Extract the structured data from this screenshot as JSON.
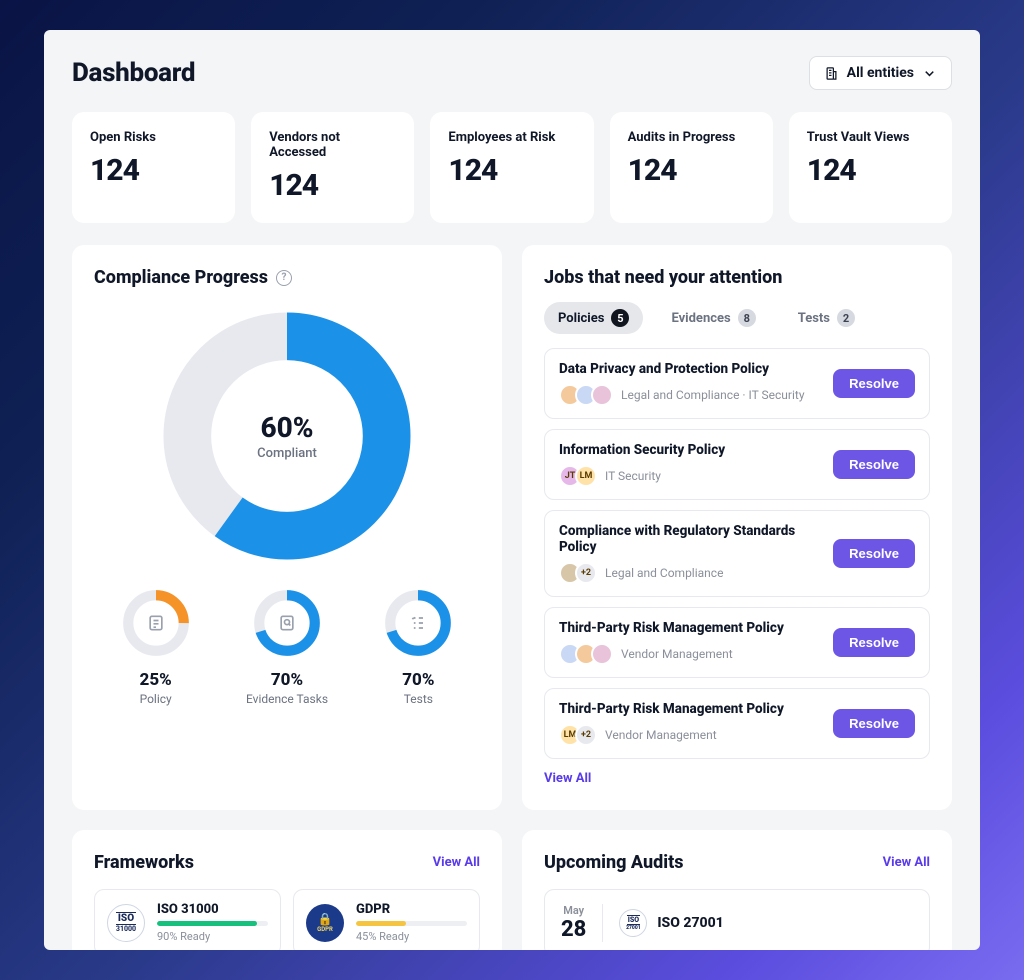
{
  "page_title": "Dashboard",
  "entity_selector": {
    "label": "All entities"
  },
  "stats": [
    {
      "label": "Open Risks",
      "value": "124"
    },
    {
      "label": "Vendors not Accessed",
      "value": "124"
    },
    {
      "label": "Employees at Risk",
      "value": "124"
    },
    {
      "label": "Audits in Progress",
      "value": "124"
    },
    {
      "label": "Trust Vault Views",
      "value": "124"
    }
  ],
  "compliance": {
    "title": "Compliance Progress",
    "main_pct": "60%",
    "main_sub": "Compliant",
    "mini": [
      {
        "pct": "25%",
        "label": "Policy",
        "color": "#f59328",
        "value": 25
      },
      {
        "pct": "70%",
        "label": "Evidence Tasks",
        "color": "#1c91e8",
        "value": 70
      },
      {
        "pct": "70%",
        "label": "Tests",
        "color": "#1c91e8",
        "value": 70
      }
    ]
  },
  "chart_data": {
    "type": "pie",
    "title": "Compliance Progress",
    "series": [
      {
        "name": "Compliant",
        "value": 60
      },
      {
        "name": "Remaining",
        "value": 40
      }
    ],
    "sub_charts": [
      {
        "name": "Policy",
        "value": 25,
        "type": "donut"
      },
      {
        "name": "Evidence Tasks",
        "value": 70,
        "type": "donut"
      },
      {
        "name": "Tests",
        "value": 70,
        "type": "donut"
      }
    ]
  },
  "jobs": {
    "title": "Jobs that need your attention",
    "tabs": [
      {
        "label": "Policies",
        "count": "5",
        "active": true
      },
      {
        "label": "Evidences",
        "count": "8",
        "active": false
      },
      {
        "label": "Tests",
        "count": "2",
        "active": false
      }
    ],
    "items": [
      {
        "title": "Data Privacy and Protection Policy",
        "dept": "Legal and Compliance · IT Security",
        "avatars": [
          {
            "bg": "#f4c99b"
          },
          {
            "bg": "#c9d8f4"
          },
          {
            "bg": "#e8c3d9"
          }
        ]
      },
      {
        "title": "Information Security Policy",
        "dept": "IT Security",
        "avatars": [
          {
            "bg": "#e6b8ea",
            "text": "JT"
          },
          {
            "bg": "#ffe2a8",
            "text": "LM"
          }
        ]
      },
      {
        "title": "Compliance with Regulatory Standards Policy",
        "dept": "Legal and Compliance",
        "avatars": [
          {
            "bg": "#d8c6a8"
          },
          {
            "bg": "#e7e9ee",
            "text": "+2"
          }
        ]
      },
      {
        "title": "Third-Party Risk Management Policy",
        "dept": "Vendor Management",
        "avatars": [
          {
            "bg": "#c9d8f4"
          },
          {
            "bg": "#f4c99b"
          },
          {
            "bg": "#e8c3d9"
          }
        ]
      },
      {
        "title": "Third-Party Risk Management Policy",
        "dept": "Vendor Management",
        "avatars": [
          {
            "bg": "#ffe2a8",
            "text": "LM"
          },
          {
            "bg": "#e7e9ee",
            "text": "+2"
          }
        ]
      }
    ],
    "resolve_label": "Resolve",
    "view_all": "View All"
  },
  "frameworks": {
    "title": "Frameworks",
    "view_all": "View All",
    "items": [
      {
        "name": "ISO 31000",
        "ready": "90% Ready",
        "pct": 90,
        "color": "#17c07d",
        "icon": "ISO",
        "icon_sub": "31000",
        "icon_bg": "#fff",
        "icon_border": "#1a2a5a"
      },
      {
        "name": "GDPR",
        "ready": "45% Ready",
        "pct": 45,
        "color": "#f5c542",
        "icon": "GDPR",
        "icon_bg": "#1b3a8a",
        "icon_color": "#f5d862"
      }
    ]
  },
  "audits": {
    "title": "Upcoming Audits",
    "view_all": "View All",
    "items": [
      {
        "month": "May",
        "day": "28",
        "name": "ISO 27001"
      }
    ]
  }
}
